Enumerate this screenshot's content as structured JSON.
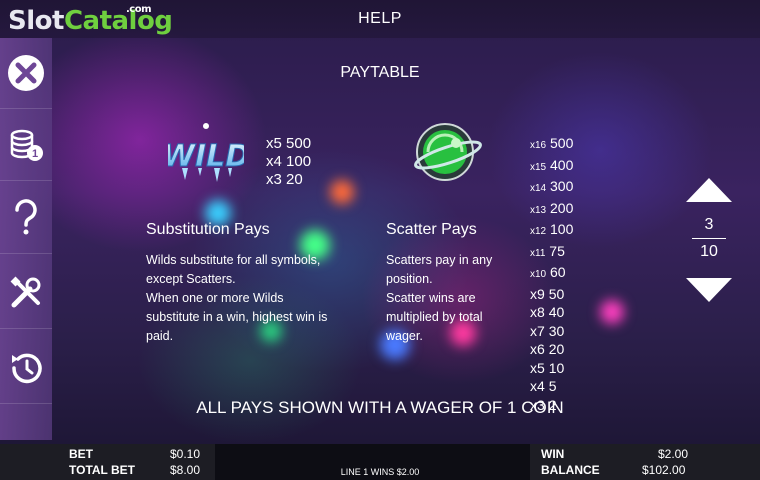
{
  "logo": {
    "slot": "Slot",
    "catalog": "Catalog",
    "com": ".com"
  },
  "header": {
    "title": "HELP"
  },
  "sidebar": {
    "close_icon": "close-icon",
    "coins_icon": "coins-icon",
    "coins_badge": "1",
    "help_icon": "question-icon",
    "settings_icon": "settings-icon",
    "history_icon": "history-icon"
  },
  "paytable": {
    "title": "PAYTABLE",
    "wild": {
      "symbol_text": "WILD",
      "pays": [
        {
          "mult": "x5",
          "value": "500"
        },
        {
          "mult": "x4",
          "value": "100"
        },
        {
          "mult": "x3",
          "value": "20"
        }
      ],
      "title": "Substitution Pays",
      "body": [
        "Wilds substitute for all symbols,",
        "except Scatters.",
        "When one or more Wilds",
        "substitute in a win, highest win is",
        "paid."
      ]
    },
    "scatter": {
      "pays": [
        {
          "mult": "x16",
          "value": "500",
          "big": false
        },
        {
          "mult": "x15",
          "value": "400",
          "big": false
        },
        {
          "mult": "x14",
          "value": "300",
          "big": false
        },
        {
          "mult": "x13",
          "value": "200",
          "big": false
        },
        {
          "mult": "x12",
          "value": "100",
          "big": false
        },
        {
          "mult": "x11",
          "value": "75",
          "big": false
        },
        {
          "mult": "x10",
          "value": "60",
          "big": false
        },
        {
          "mult": "x9",
          "value": "50",
          "big": true
        },
        {
          "mult": "x8",
          "value": "40",
          "big": true
        },
        {
          "mult": "x7",
          "value": "30",
          "big": true
        },
        {
          "mult": "x6",
          "value": "20",
          "big": true
        },
        {
          "mult": "x5",
          "value": "10",
          "big": true
        },
        {
          "mult": "x4",
          "value": "5",
          "big": true
        },
        {
          "mult": "x3",
          "value": "2",
          "big": true
        }
      ],
      "title": "Scatter Pays",
      "body": [
        "Scatters pay in any",
        "position.",
        "Scatter wins are",
        "multiplied by total",
        "wager."
      ]
    },
    "footer_note": "ALL PAYS SHOWN WITH A WAGER OF 1 COIN"
  },
  "pager": {
    "current": "3",
    "total": "10"
  },
  "bottom": {
    "bet_label": "BET",
    "bet_value": "$0.10",
    "total_bet_label": "TOTAL BET",
    "total_bet_value": "$8.00",
    "line_win": "LINE 1 WINS $2.00",
    "win_label": "WIN",
    "win_value": "$2.00",
    "balance_label": "BALANCE",
    "balance_value": "$102.00"
  },
  "colors": {
    "logo_green": "#6fcf3f",
    "sidebar": "#6e4696"
  }
}
